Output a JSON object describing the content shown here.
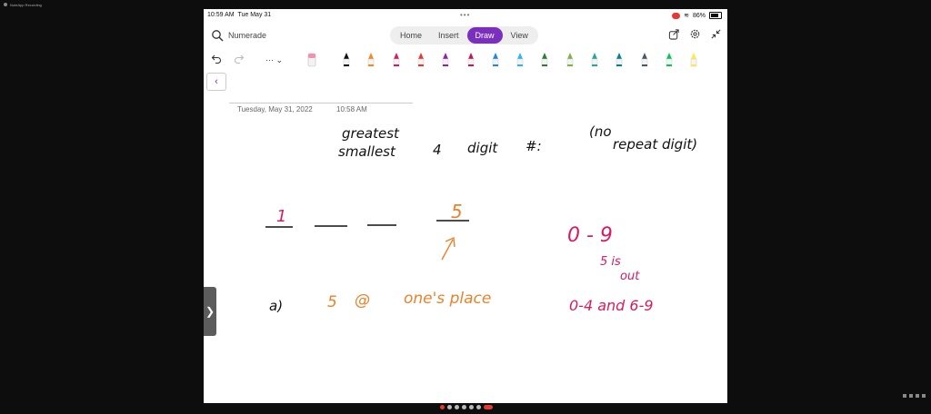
{
  "window": {
    "title": "NoteApp Recording"
  },
  "status_bar": {
    "time": "10:59 AM",
    "date": "Tue May 31",
    "battery": "86%"
  },
  "app_bar": {
    "app_name": "Numerade",
    "tabs": [
      {
        "label": "Home",
        "active": false
      },
      {
        "label": "Insert",
        "active": false
      },
      {
        "label": "Draw",
        "active": true
      },
      {
        "label": "View",
        "active": false
      }
    ]
  },
  "toolbar": {
    "more_label": "···",
    "pens": [
      {
        "color": "#111111"
      },
      {
        "color": "#f08a24"
      },
      {
        "color": "#d81b60"
      },
      {
        "color": "#e53935"
      },
      {
        "color": "#8e24aa"
      },
      {
        "color": "#c2185b"
      },
      {
        "color": "#1e88e5"
      },
      {
        "color": "#29b6f6"
      },
      {
        "color": "#2e7d32"
      },
      {
        "color": "#7cb342"
      },
      {
        "color": "#26a69a"
      },
      {
        "color": "#00838f"
      },
      {
        "color": "#455a64"
      },
      {
        "color": "#00c853"
      },
      {
        "color": "#ffeb3b"
      }
    ]
  },
  "page": {
    "date": "Tuesday, May 31, 2022",
    "time": "10:58 AM"
  },
  "ink": {
    "line1_word": "greatest",
    "line2_word": "smallest",
    "four": "4",
    "digit": "digit",
    "hash": "#:",
    "paren_no": "(no",
    "repeat_digit": "repeat digit)",
    "first_digit": "1",
    "last_digit": "5",
    "part_a": "a)",
    "five": "5",
    "at": "@",
    "ones_place": "one's place",
    "range": "0 - 9",
    "five_is": "5 is",
    "out": "out",
    "range2": "0-4 and 6-9",
    "colors": {
      "black": "#111111",
      "pink": "#d81b60",
      "orange": "#e9822b"
    }
  }
}
